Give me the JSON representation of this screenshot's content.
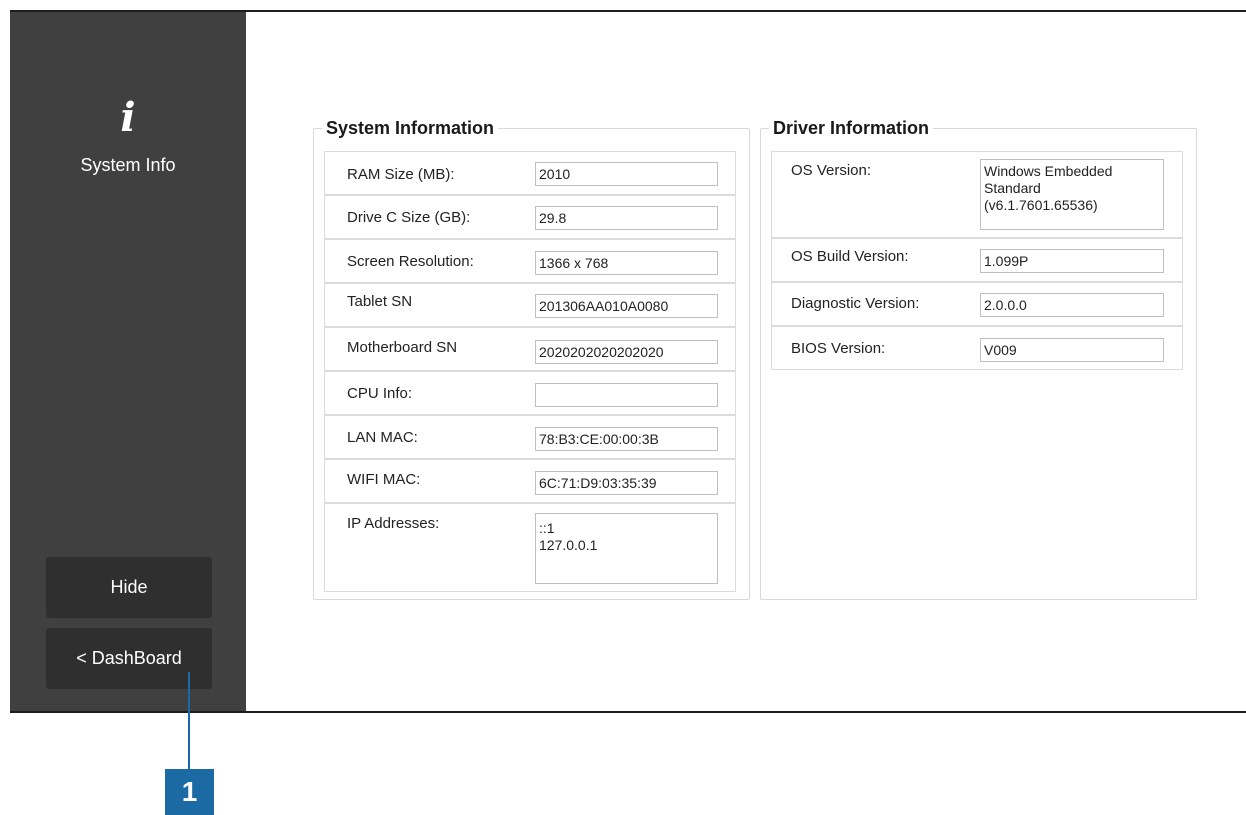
{
  "sidebar": {
    "icon_glyph": "i",
    "label": "System Info",
    "hide_button": "Hide",
    "dashboard_button": "< DashBoard"
  },
  "system_information": {
    "title": "System Information",
    "rows": [
      {
        "label": "RAM Size (MB):",
        "value": "2010"
      },
      {
        "label": "Drive C Size (GB):",
        "value": "29.8"
      },
      {
        "label": "Screen Resolution:",
        "value": "1366 x 768"
      },
      {
        "label": "Tablet SN",
        "value": "201306AA010A0080"
      },
      {
        "label": "Motherboard SN",
        "value": "2020202020202020"
      },
      {
        "label": "CPU Info:",
        "value": ""
      },
      {
        "label": "LAN MAC:",
        "value": "78:B3:CE:00:00:3B"
      },
      {
        "label": "WIFI MAC:",
        "value": "6C:71:D9:03:35:39"
      },
      {
        "label": "IP Addresses:",
        "value": "::1\n127.0.0.1"
      }
    ]
  },
  "driver_information": {
    "title": "Driver Information",
    "rows": [
      {
        "label": "OS Version:",
        "value": "Windows Embedded\nStandard\n(v6.1.7601.65536)"
      },
      {
        "label": "OS Build Version:",
        "value": "1.099P"
      },
      {
        "label": "Diagnostic Version:",
        "value": "2.0.0.0"
      },
      {
        "label": "BIOS Version:",
        "value": "V009"
      }
    ]
  },
  "callout": {
    "number": "1"
  },
  "colors": {
    "sidebar_bg": "#404040",
    "button_bg": "#2f2f2f",
    "callout": "#1c6aa3"
  }
}
